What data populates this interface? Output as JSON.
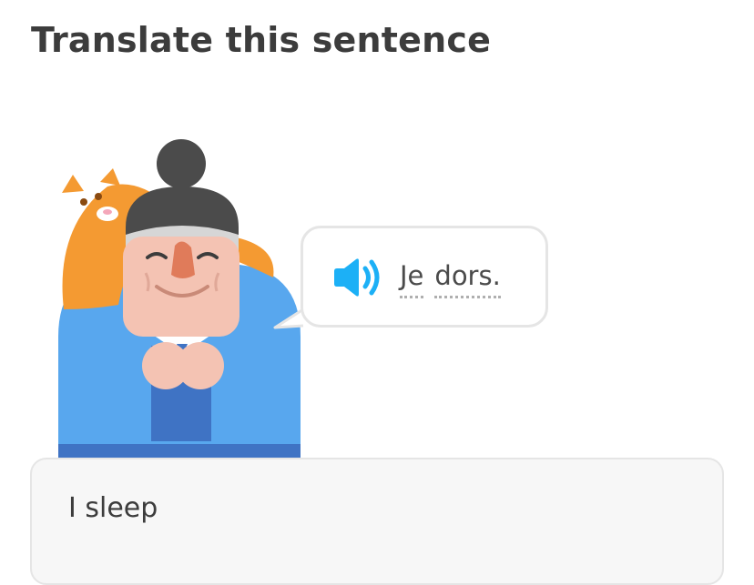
{
  "header": {
    "title": "Translate this sentence"
  },
  "prompt": {
    "words": [
      "Je",
      "dors."
    ],
    "audio_icon": "speaker-icon"
  },
  "answer": {
    "value": "I sleep"
  },
  "colors": {
    "title": "#3c3c3c",
    "speaker_blue": "#1cb0f6",
    "robe_light": "#58a7ee",
    "robe_dark": "#3f73c4",
    "cat_orange": "#f49a32",
    "bubble_border": "#e5e5e5",
    "answer_bg": "#f7f7f7"
  }
}
